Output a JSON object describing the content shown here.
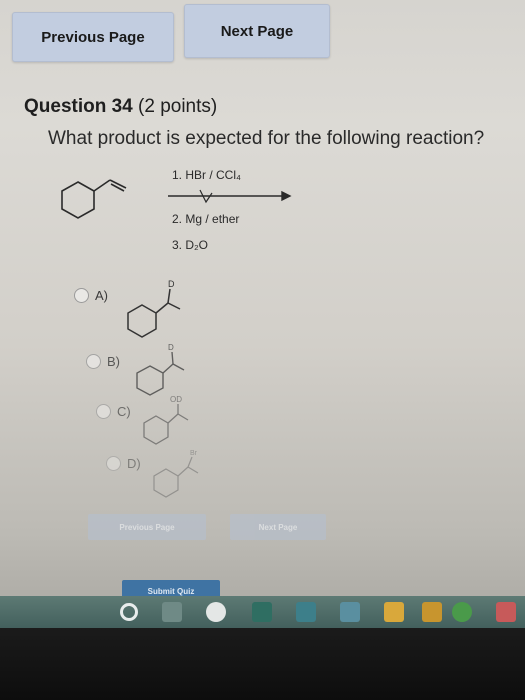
{
  "nav": {
    "previous_label": "Previous Page",
    "next_label": "Next Page"
  },
  "question": {
    "number_label": "Question 34",
    "points_label": "(2 points)",
    "text": "What product is expected for the following reaction?"
  },
  "reaction": {
    "step1": "1. HBr / CCl₄",
    "step2": "2. Mg / ether",
    "step3": "3. D₂O"
  },
  "choices": [
    {
      "label": "A)",
      "group_label": "D"
    },
    {
      "label": "B)",
      "group_label": "D"
    },
    {
      "label": "C)",
      "group_label": "OD"
    },
    {
      "label": "D)",
      "group_label": "Br"
    }
  ],
  "footer": {
    "previous_label": "Previous Page",
    "next_label": "Next Page",
    "submit_label": "Submit Quiz"
  },
  "taskbar": {
    "icons": [
      "cortana-icon",
      "task-view-icon",
      "settings-icon",
      "store-icon",
      "mail-icon",
      "photos-icon",
      "office-icon",
      "files-icon",
      "chrome-icon",
      "app-icon"
    ]
  }
}
